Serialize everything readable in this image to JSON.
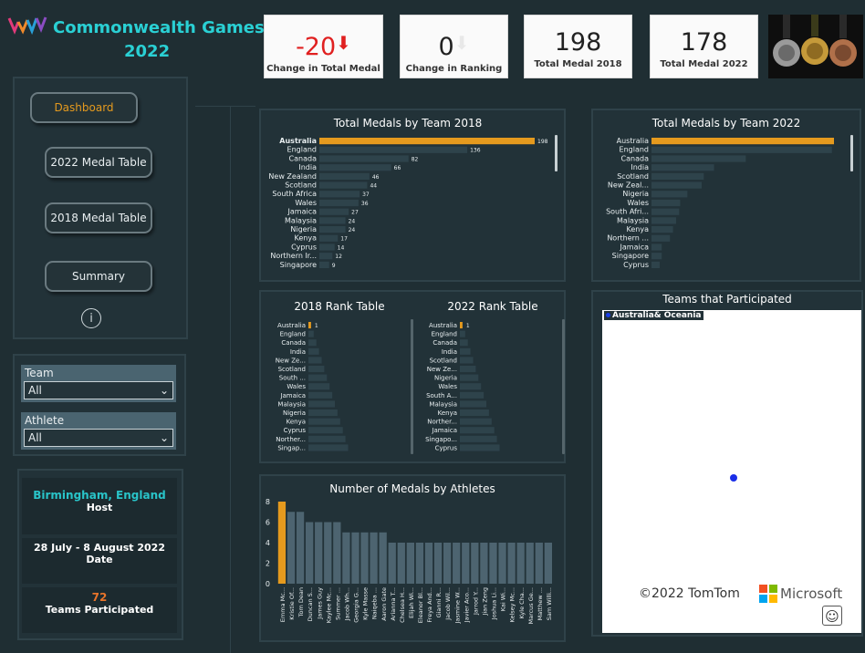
{
  "header": {
    "title_line1": "Commonwealth Games",
    "title_line2": "2022"
  },
  "kpis": [
    {
      "value": "-20",
      "label": "Change in Total Medal",
      "arrow": "⬇",
      "color": "#e02020"
    },
    {
      "value": "0",
      "label": "Change in Ranking",
      "arrow": "⬇",
      "color": "#222222"
    },
    {
      "value": "198",
      "label": "Total Medal 2018"
    },
    {
      "value": "178",
      "label": "Total Medal 2022"
    }
  ],
  "nav": {
    "dashboard": "Dashboard",
    "medal2022": "2022 Medal Table",
    "medal2018": "2018 Medal Table",
    "summary": "Summary",
    "info_icon": "info-icon"
  },
  "filters": {
    "team_label": "Team",
    "team_value": "All",
    "athlete_label": "Athlete",
    "athlete_value": "All"
  },
  "info": {
    "host_city": "Birmingham, England",
    "host_label": "Host",
    "dates": "28 July - 8 August 2022",
    "date_label": "Date",
    "teams_count": "72",
    "teams_label": "Teams Participated"
  },
  "colors": {
    "accent": "#e59a1e",
    "bar": "#2e434b",
    "highlight": "#e59a1e",
    "teal": "#29c4c9"
  },
  "map": {
    "title": "Teams that Participated",
    "legend": "Australia& Oceania",
    "copyright": "©2022 TomTom",
    "brand": "Microsoft"
  },
  "chart_data": [
    {
      "type": "bar",
      "title": "Total Medals by Team 2018",
      "categories": [
        "Australia",
        "England",
        "Canada",
        "India",
        "New Zealand",
        "Scotland",
        "South Africa",
        "Wales",
        "Jamaica",
        "Malaysia",
        "Nigeria",
        "Kenya",
        "Cyprus",
        "Northern Ir...",
        "Singapore"
      ],
      "values": [
        198,
        136,
        82,
        66,
        46,
        44,
        37,
        36,
        27,
        24,
        24,
        17,
        14,
        12,
        9
      ],
      "data_labels": true
    },
    {
      "type": "bar",
      "title": "Total Medals by Team 2022",
      "categories": [
        "Australia",
        "England",
        "Canada",
        "India",
        "Scotland",
        "New Zeal...",
        "Nigeria",
        "Wales",
        "South Afri...",
        "Malaysia",
        "Kenya",
        "Northern ...",
        "Jamaica",
        "Singapore",
        "Cyprus"
      ],
      "values": [
        178,
        176,
        92,
        61,
        51,
        49,
        35,
        28,
        27,
        24,
        21,
        18,
        10,
        10,
        8
      ],
      "data_labels": false
    },
    {
      "type": "bar",
      "title": "2018 Rank Table",
      "categories": [
        "Australia",
        "England",
        "Canada",
        "India",
        "New Ze...",
        "Scotland",
        "South ...",
        "Wales",
        "Jamaica",
        "Malaysia",
        "Nigeria",
        "Kenya",
        "Cyprus",
        "Norther...",
        "Singap..."
      ],
      "values": [
        1,
        2,
        3,
        4,
        5,
        6,
        7,
        8,
        9,
        10,
        11,
        12,
        13,
        14,
        15
      ],
      "data_labels": [
        "1"
      ]
    },
    {
      "type": "bar",
      "title": "2022 Rank Table",
      "categories": [
        "Australia",
        "England",
        "Canada",
        "India",
        "Scotland",
        "New Ze...",
        "Nigeria",
        "Wales",
        "South A...",
        "Malaysia",
        "Kenya",
        "Norther...",
        "Jamaica",
        "Singapo...",
        "Cyprus"
      ],
      "values": [
        1,
        2,
        3,
        4,
        5,
        6,
        7,
        8,
        9,
        10,
        11,
        12,
        13,
        14,
        15
      ],
      "data_labels": [
        "1"
      ]
    },
    {
      "type": "bar",
      "title": "Number of Medals by Athletes",
      "ylim": [
        0,
        8
      ],
      "yticks": [
        "0",
        "2",
        "4",
        "6",
        "8"
      ],
      "categories": [
        "Emma Mc...",
        "Kristie Of...",
        "Tom Dean",
        "Duncan S...",
        "James Guy",
        "Kaylee Mc...",
        "Summer ...",
        "Jacob Wh...",
        "Georgia G...",
        "Kyle Masse",
        "Naiqeba ...",
        "Aaron Gate",
        "Arianna T...",
        "Chelsea H...",
        "Elijah Wi...",
        "Eleanor Bl...",
        "Freya And...",
        "Gianni R...",
        "Jacob Wil...",
        "Jasmine W...",
        "Javier Aco...",
        "Jarrod Y...",
        "Jian Zeng",
        "Joshua Li...",
        "Kai Wi...",
        "Kelsey Mc...",
        "Kyle Cha...",
        "Marcus Ge...",
        "Matthew ...",
        "Sam Willi..."
      ],
      "values": [
        8,
        7,
        7,
        6,
        6,
        6,
        6,
        5,
        5,
        5,
        5,
        5,
        4,
        4,
        4,
        4,
        4,
        4,
        4,
        4,
        4,
        4,
        4,
        4,
        4,
        4,
        4,
        4,
        4,
        4
      ]
    }
  ]
}
